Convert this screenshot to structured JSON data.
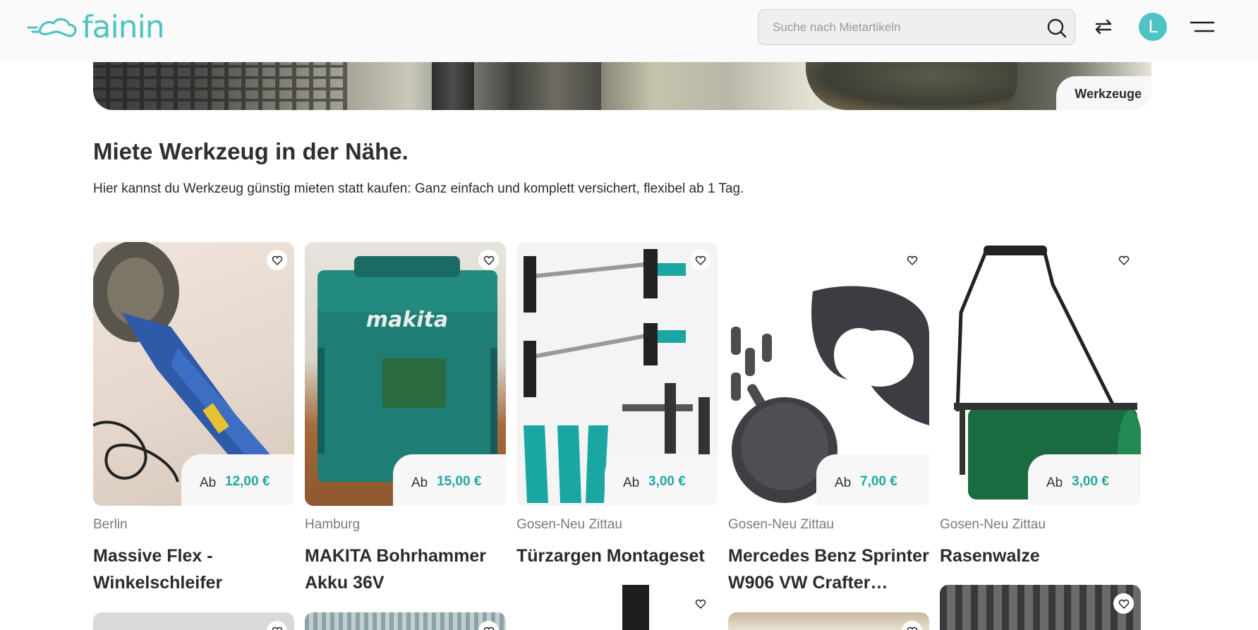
{
  "header": {
    "logo_text": "fainin",
    "search_placeholder": "Suche nach Mietartikeln",
    "avatar_initial": "L",
    "brand_color": "#4fc3c3"
  },
  "banner": {
    "category_label": "Werkzeuge"
  },
  "main": {
    "title": "Miete Werkzeug in der Nähe.",
    "subtitle": "Hier kannst du Werkzeug günstig mieten statt kaufen: Ganz einfach und komplett versichert, flexibel ab 1 Tag."
  },
  "products": [
    {
      "location": "Berlin",
      "name": "Massive Flex - Winkelschleifer",
      "price_prefix": "Ab",
      "price": "12,00 €",
      "icon": "heart-icon"
    },
    {
      "location": "Hamburg",
      "name": "MAKITA Bohrhammer Akku 36V",
      "price_prefix": "Ab",
      "price": "15,00 €",
      "icon": "heart-icon"
    },
    {
      "location": "Gosen-Neu Zittau",
      "name": "Türzargen Montageset",
      "price_prefix": "Ab",
      "price": "3,00 €",
      "icon": "heart-icon"
    },
    {
      "location": "Gosen-Neu Zittau",
      "name": "Mercedes Benz Sprinter W906 VW Crafter…",
      "price_prefix": "Ab",
      "price": "7,00 €",
      "icon": "heart-icon"
    },
    {
      "location": "Gosen-Neu Zittau",
      "name": "Rasenwalze",
      "price_prefix": "Ab",
      "price": "3,00 €",
      "icon": "heart-icon"
    }
  ],
  "colors": {
    "accent": "#22a7a7",
    "text": "#2b2b2b",
    "muted": "#7a7a7a"
  }
}
